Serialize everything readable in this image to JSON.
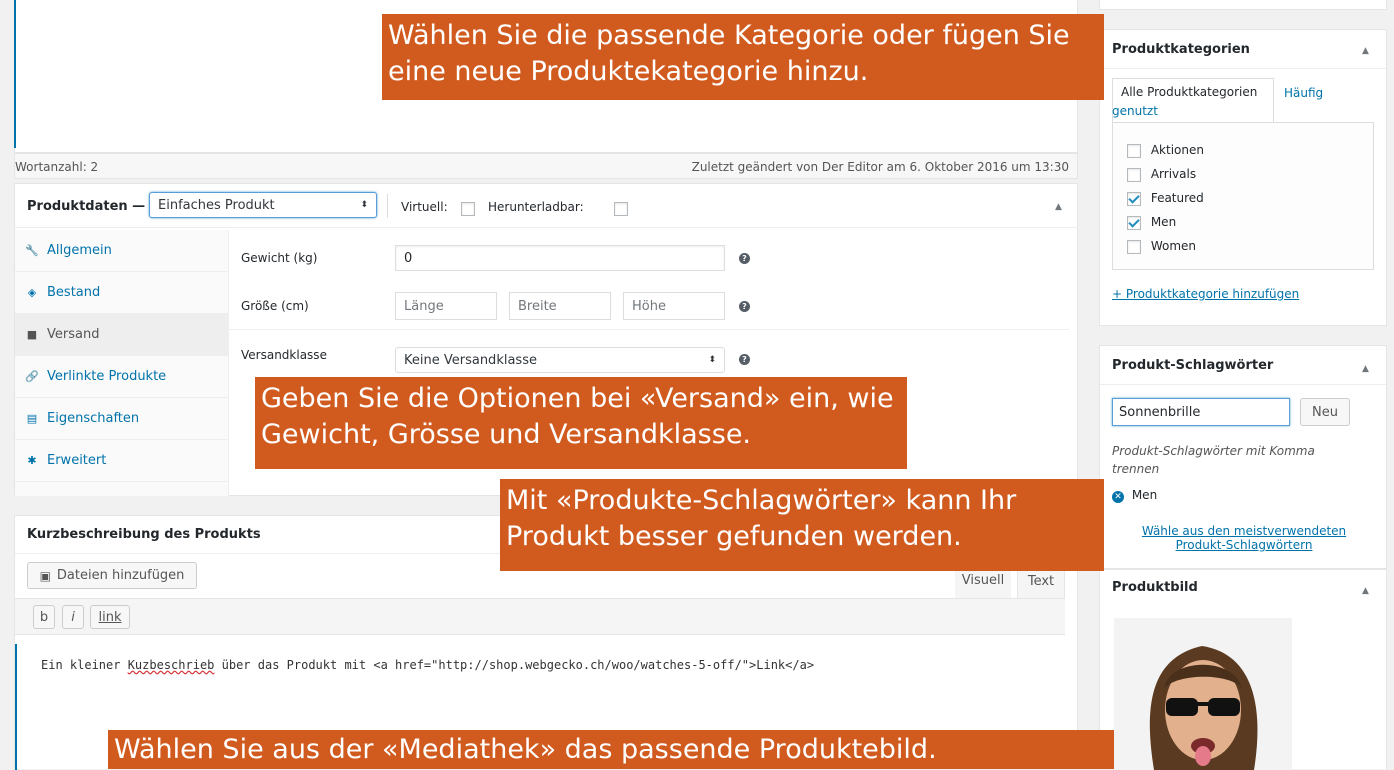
{
  "editor": {
    "word_count": "Wortanzahl: 2",
    "last_modified": "Zuletzt geändert von Der Editor am 6. Oktober 2016 um 13:30"
  },
  "product_data": {
    "title": "Produktdaten —",
    "type_select": "Einfaches Produkt",
    "virtual_label": "Virtuell:",
    "downloadable_label": "Herunterladbar:",
    "tabs": [
      {
        "label": "Allgemein",
        "icon": "wrench-icon",
        "glyph": "🔧"
      },
      {
        "label": "Bestand",
        "icon": "tag-icon",
        "glyph": "◈"
      },
      {
        "label": "Versand",
        "icon": "truck-icon",
        "glyph": "■"
      },
      {
        "label": "Verlinkte Produkte",
        "icon": "link-icon",
        "glyph": "🔗"
      },
      {
        "label": "Eigenschaften",
        "icon": "list-icon",
        "glyph": "▤"
      },
      {
        "label": "Erweitert",
        "icon": "gear-icon",
        "glyph": "✱"
      }
    ],
    "weight_label": "Gewicht (kg)",
    "weight_value": "0",
    "size_label": "Größe (cm)",
    "length_placeholder": "Länge",
    "width_placeholder": "Breite",
    "height_placeholder": "Höhe",
    "shipping_class_label": "Versandklasse",
    "shipping_class_value": "Keine Versandklasse"
  },
  "short_description": {
    "title": "Kurzbeschreibung des Produkts",
    "add_media": "Dateien hinzufügen",
    "tab_visual": "Visuell",
    "tab_text": "Text",
    "qt_bold": "b",
    "qt_italic": "i",
    "qt_link": "link",
    "content_before": "Ein kleiner ",
    "content_misspelled": "Kuzbeschrieb",
    "content_after": " über das Produkt mit <a href=\"http://shop.webgecko.ch/woo/watches-5-off/\">Link</a>"
  },
  "categories": {
    "title": "Produktkategorien",
    "tab_all": "Alle Produktkategorien",
    "tab_popular": "Häufig genutzt",
    "items": [
      {
        "label": "Aktionen",
        "checked": false
      },
      {
        "label": "Arrivals",
        "checked": false
      },
      {
        "label": "Featured",
        "checked": true
      },
      {
        "label": "Men",
        "checked": true
      },
      {
        "label": "Women",
        "checked": false
      }
    ],
    "add_link": "+ Produktkategorie hinzufügen"
  },
  "tags": {
    "title": "Produkt-Schlagwörter",
    "input_value": "Sonnenbrille",
    "add_button": "Neu",
    "hint": "Produkt-Schlagwörter mit Komma trennen",
    "tag": "Men",
    "most_used_link": "Wähle aus den meistverwendeten Produkt-Schlagwörtern"
  },
  "image": {
    "title": "Produktbild"
  },
  "callouts": {
    "category": "Wählen Sie die passende Kategorie oder fügen Sie eine neue Produktekategorie hinzu.",
    "shipping": "Geben Sie die Optionen bei «Versand» ein, wie Gewicht, Grösse und Versandklasse.",
    "tags": "Mit «Produkte-Schlagwörter» kann Ihr Produkt besser gefunden werden.",
    "media": "Wählen Sie aus der «Mediathek» das passende Produktebild."
  },
  "colors": {
    "accent": "#0073aa",
    "callout": "#d15b1f"
  }
}
